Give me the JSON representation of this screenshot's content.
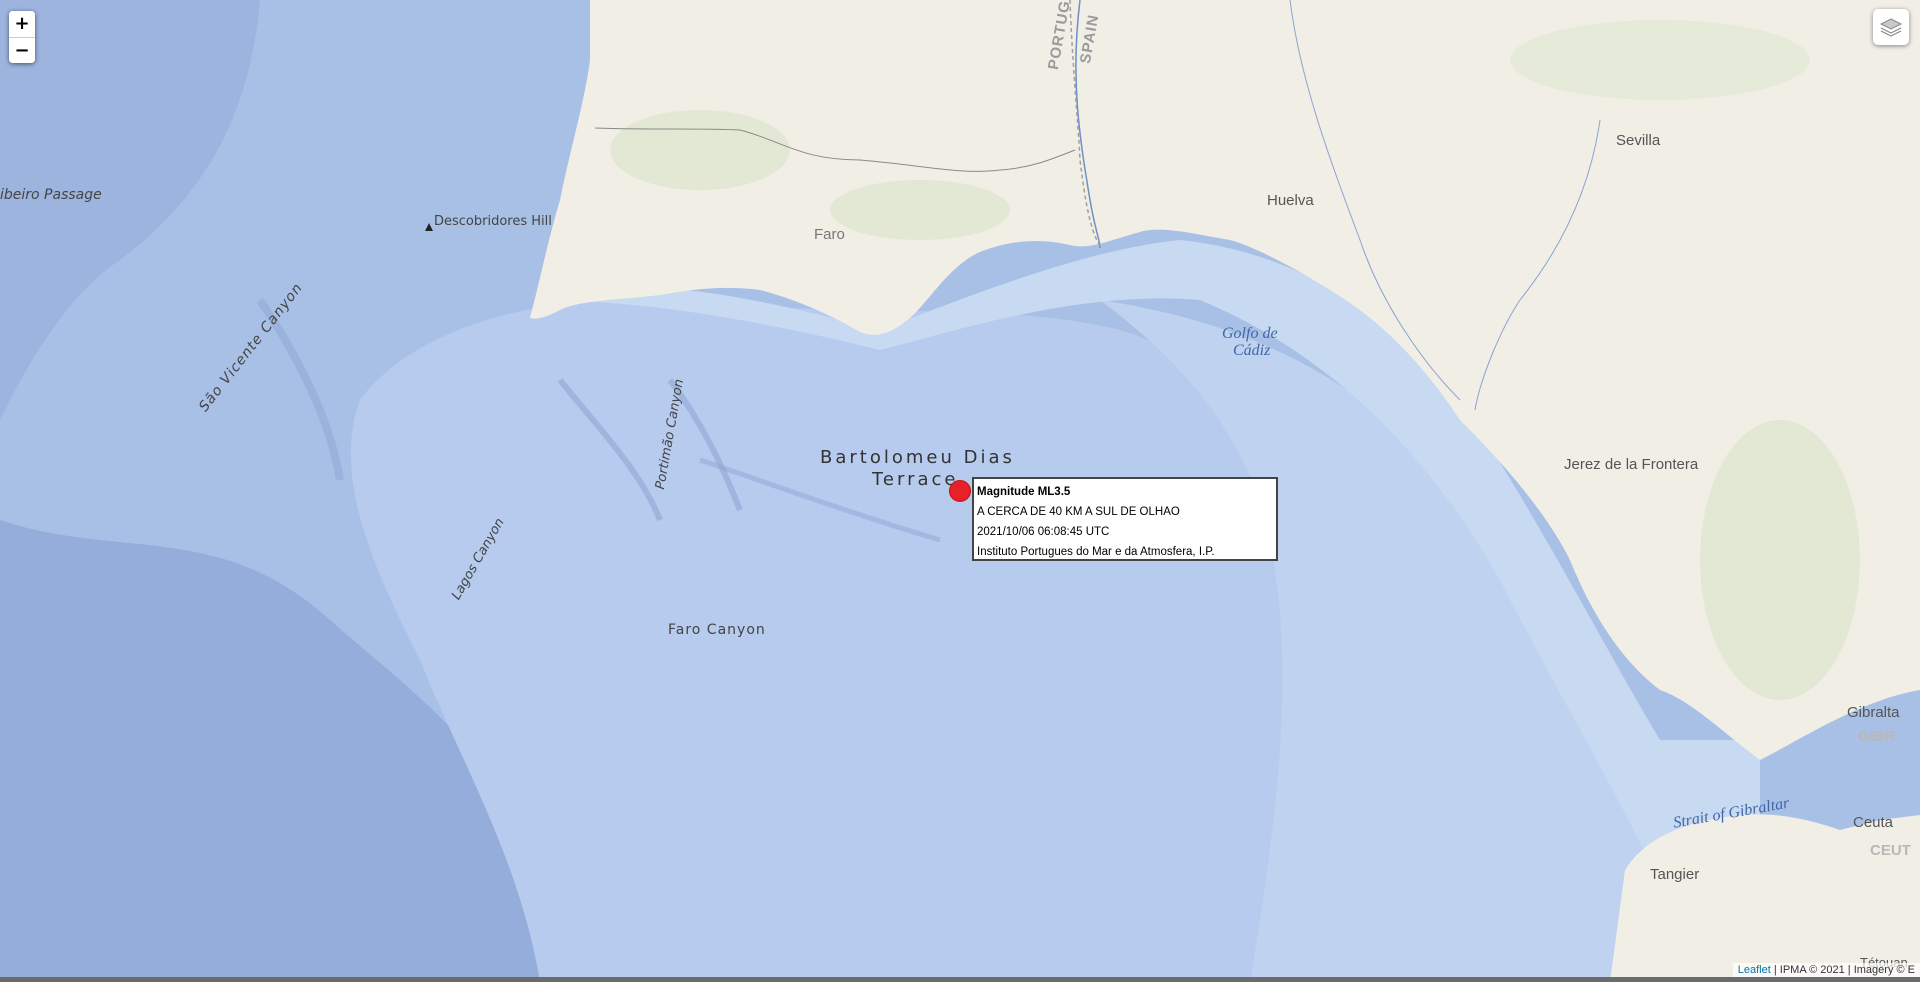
{
  "map": {
    "zoom_in_label": "+",
    "zoom_out_label": "−",
    "layers_icon": "layers-icon"
  },
  "labels": {
    "cities": {
      "faro": "Faro",
      "huelva": "Huelva",
      "sevilla": "Sevilla",
      "jerez": "Jerez de la Frontera",
      "tangier": "Tangier",
      "ceuta": "Ceuta",
      "gibraltar": "Gibralta",
      "tetouan": "Tétouan"
    },
    "borders": {
      "portugal": "PORTUGAL",
      "spain": "SPAIN",
      "gibraltar_country": "GIBR",
      "ceuta_region": "CEUT"
    },
    "seas": {
      "golfo_line1": "Golfo de",
      "golfo_line2": "Cádiz",
      "strait": "Strait of Gibraltar"
    },
    "features": {
      "ribeiro_passage": "ibeiro Passage",
      "descobridores_hill": "Descobridores Hill",
      "sao_vicente_canyon": "São Vicente Canyon",
      "portimao_canyon": "Portimão Canyon",
      "lagos_canyon": "Lagos Canyon",
      "faro_canyon": "Faro Canyon",
      "bartolomeu_line1": "Bartolomeu Dias",
      "bartolomeu_line2": "Terrace"
    }
  },
  "popup": {
    "title": "Magnitude ML3.5",
    "location": "A CERCA DE 40 KM A SUL DE OLHAO",
    "datetime": "2021/10/06 06:08:45 UTC",
    "source": "Instituto Portugues do Mar e da Atmosfera, I.P."
  },
  "attribution": {
    "leaflet": "Leaflet",
    "separator": "|",
    "text": "IPMA © 2021 | Imagery © E"
  },
  "colors": {
    "marker": "#e8202a",
    "deep_water": "#9fb7df",
    "shallow_water": "#c4d6ef",
    "land": "#f1eee6"
  }
}
